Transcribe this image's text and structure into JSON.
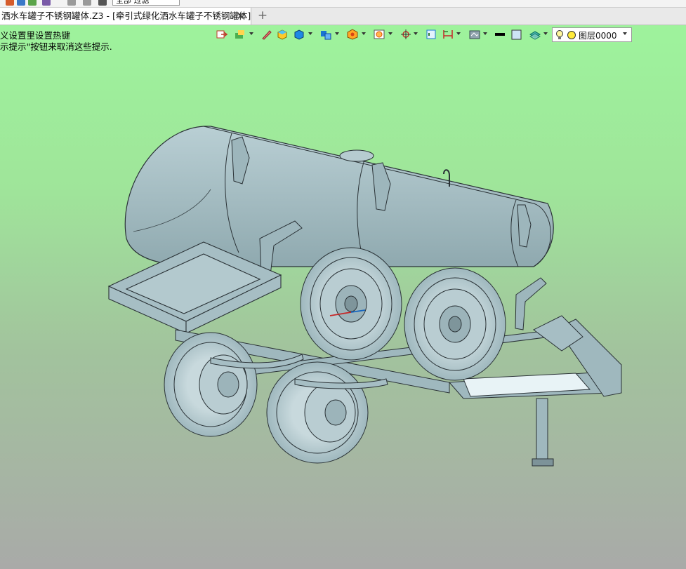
{
  "tab": {
    "title": "洒水车罐子不锈钢罐体.Z3 - [牵引式绿化洒水车罐子不锈钢罐体]",
    "close_glyph": "✕",
    "new_tab_glyph": "+"
  },
  "quick_access": {
    "filter_value": "全部  过滤"
  },
  "hints": {
    "line1": "义设置里设置热键",
    "line2": "示提示\"按钮来取消这些提示."
  },
  "view_toolbar": {
    "icons": [
      "exit-sketch-icon",
      "show-hide-icon",
      "pencil-icon",
      "shaded-cube-icon",
      "solid-cube-icon",
      "view-orient-icon",
      "render-style-icon",
      "zoom-fit-icon",
      "origin-axes-icon",
      "sketch-plane-icon",
      "dimension-icon",
      "display-filter-icon",
      "line-color-icon",
      "fill-color-icon",
      "layer-stack-icon"
    ],
    "layer": {
      "bulb_icon": "light-bulb-icon",
      "dot_icon": "layer-color-icon",
      "label": "图层0000"
    }
  },
  "colors": {
    "bg_top": "#9ef39c",
    "bg_bottom": "#a9aaa8",
    "model_fill": "#a9c3c9",
    "model_edge": "#2a3236"
  }
}
